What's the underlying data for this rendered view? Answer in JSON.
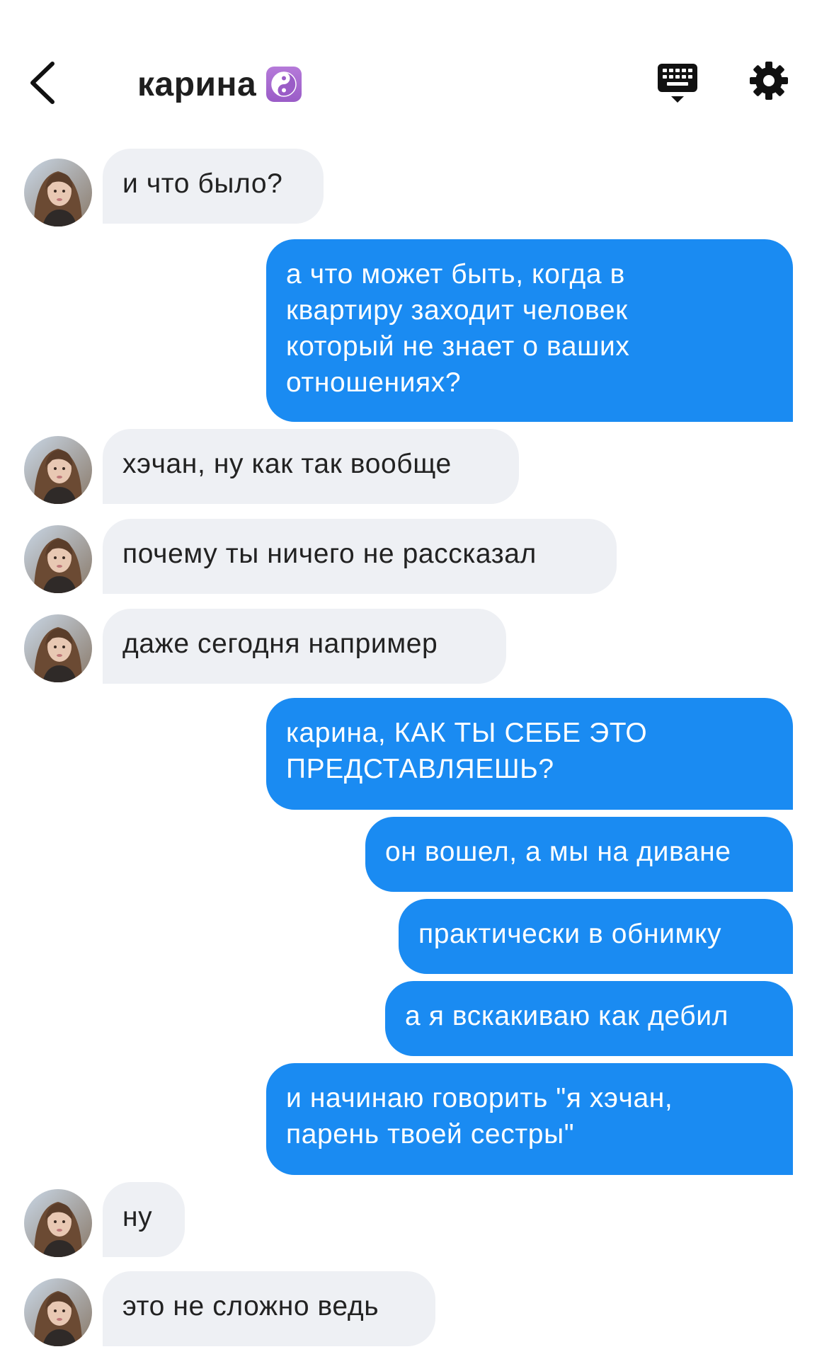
{
  "header": {
    "title": "карина",
    "title_emoji": "yin-yang",
    "icons": [
      "back-chevron-icon",
      "keyboard-icon",
      "gear-icon"
    ]
  },
  "colors": {
    "incoming_bubble": "#eef0f4",
    "outgoing_bubble": "#1a8bf2",
    "outgoing_text": "#ffffff",
    "emoji_tile": "#a865cf"
  },
  "messages": [
    {
      "from": "them",
      "text": "и что было?"
    },
    {
      "from": "me",
      "lines": [
        "а что может быть, когда в",
        "квартиру заходит человек",
        "который не знает о ваших",
        "отношениях?"
      ]
    },
    {
      "from": "them",
      "text": "хэчан, ну как так вообще"
    },
    {
      "from": "them",
      "text": "почему ты ничего не рассказал"
    },
    {
      "from": "them",
      "text": "даже сегодня например"
    },
    {
      "from": "me",
      "lines": [
        "карина, КАК ТЫ СЕБЕ ЭТО",
        "ПРЕДСТАВЛЯЕШЬ?"
      ]
    },
    {
      "from": "me",
      "text": "он вошел, а мы на диване"
    },
    {
      "from": "me",
      "text": "практически в обнимку"
    },
    {
      "from": "me",
      "text": "а я вскакиваю как дебил"
    },
    {
      "from": "me",
      "lines": [
        "и начинаю говорить \"я хэчан,",
        "парень твоей сестры\""
      ]
    },
    {
      "from": "them",
      "text": "ну"
    },
    {
      "from": "them",
      "text": "это не сложно ведь"
    }
  ]
}
